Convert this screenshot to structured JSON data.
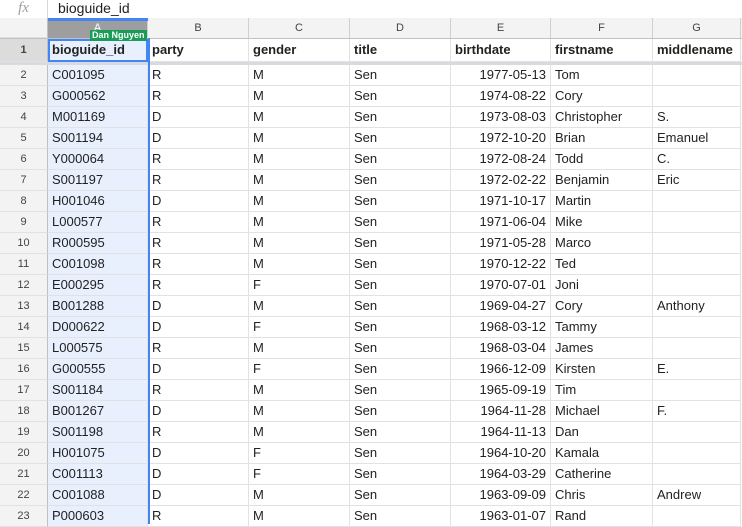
{
  "formula_bar": {
    "icon": "fx",
    "value": "bioguide_id"
  },
  "collaborator": {
    "name": "Dan Nguyen",
    "color": "#1a9c59"
  },
  "accent": "#4285f4",
  "columns": [
    "A",
    "B",
    "C",
    "D",
    "E",
    "F",
    "G"
  ],
  "rows": [
    {
      "n": "1",
      "cells": [
        "bioguide_id",
        "party",
        "gender",
        "title",
        "birthdate",
        "firstname",
        "middlename"
      ]
    },
    {
      "n": "2",
      "cells": [
        "C001095",
        "R",
        "M",
        "Sen",
        "1977-05-13",
        "Tom",
        ""
      ]
    },
    {
      "n": "3",
      "cells": [
        "G000562",
        "R",
        "M",
        "Sen",
        "1974-08-22",
        "Cory",
        ""
      ]
    },
    {
      "n": "4",
      "cells": [
        "M001169",
        "D",
        "M",
        "Sen",
        "1973-08-03",
        "Christopher",
        "S."
      ]
    },
    {
      "n": "5",
      "cells": [
        "S001194",
        "D",
        "M",
        "Sen",
        "1972-10-20",
        "Brian",
        "Emanuel"
      ]
    },
    {
      "n": "6",
      "cells": [
        "Y000064",
        "R",
        "M",
        "Sen",
        "1972-08-24",
        "Todd",
        "C."
      ]
    },
    {
      "n": "7",
      "cells": [
        "S001197",
        "R",
        "M",
        "Sen",
        "1972-02-22",
        "Benjamin",
        "Eric"
      ]
    },
    {
      "n": "8",
      "cells": [
        "H001046",
        "D",
        "M",
        "Sen",
        "1971-10-17",
        "Martin",
        ""
      ]
    },
    {
      "n": "9",
      "cells": [
        "L000577",
        "R",
        "M",
        "Sen",
        "1971-06-04",
        "Mike",
        ""
      ]
    },
    {
      "n": "10",
      "cells": [
        "R000595",
        "R",
        "M",
        "Sen",
        "1971-05-28",
        "Marco",
        ""
      ]
    },
    {
      "n": "11",
      "cells": [
        "C001098",
        "R",
        "M",
        "Sen",
        "1970-12-22",
        "Ted",
        ""
      ]
    },
    {
      "n": "12",
      "cells": [
        "E000295",
        "R",
        "F",
        "Sen",
        "1970-07-01",
        "Joni",
        ""
      ]
    },
    {
      "n": "13",
      "cells": [
        "B001288",
        "D",
        "M",
        "Sen",
        "1969-04-27",
        "Cory",
        "Anthony"
      ]
    },
    {
      "n": "14",
      "cells": [
        "D000622",
        "D",
        "F",
        "Sen",
        "1968-03-12",
        "Tammy",
        ""
      ]
    },
    {
      "n": "15",
      "cells": [
        "L000575",
        "R",
        "M",
        "Sen",
        "1968-03-04",
        "James",
        ""
      ]
    },
    {
      "n": "16",
      "cells": [
        "G000555",
        "D",
        "F",
        "Sen",
        "1966-12-09",
        "Kirsten",
        "E."
      ]
    },
    {
      "n": "17",
      "cells": [
        "S001184",
        "R",
        "M",
        "Sen",
        "1965-09-19",
        "Tim",
        ""
      ]
    },
    {
      "n": "18",
      "cells": [
        "B001267",
        "D",
        "M",
        "Sen",
        "1964-11-28",
        "Michael",
        "F."
      ]
    },
    {
      "n": "19",
      "cells": [
        "S001198",
        "R",
        "M",
        "Sen",
        "1964-11-13",
        "Dan",
        ""
      ]
    },
    {
      "n": "20",
      "cells": [
        "H001075",
        "D",
        "F",
        "Sen",
        "1964-10-20",
        "Kamala",
        ""
      ]
    },
    {
      "n": "21",
      "cells": [
        "C001113",
        "D",
        "F",
        "Sen",
        "1964-03-29",
        "Catherine",
        ""
      ]
    },
    {
      "n": "22",
      "cells": [
        "C001088",
        "D",
        "M",
        "Sen",
        "1963-09-09",
        "Chris",
        "Andrew"
      ]
    },
    {
      "n": "23",
      "cells": [
        "P000603",
        "R",
        "M",
        "Sen",
        "1963-01-07",
        "Rand",
        ""
      ]
    }
  ]
}
